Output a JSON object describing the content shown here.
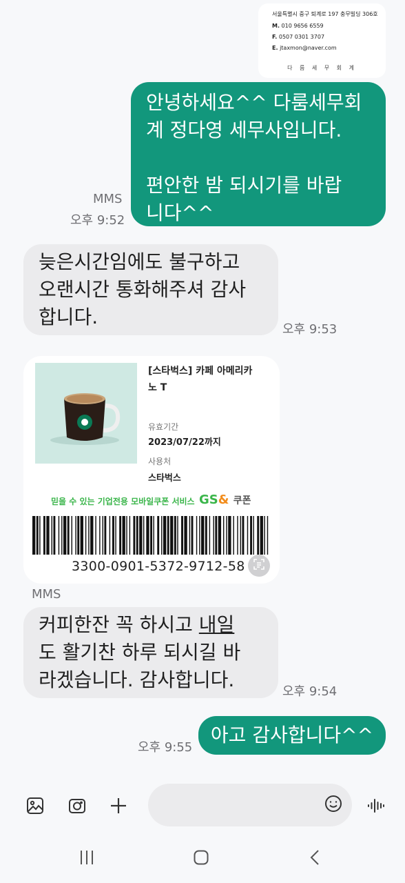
{
  "business_card": {
    "address": "서울특별시 중구 퇴계로 197 충무빌딩 306호",
    "mobile_label": "M.",
    "mobile": "010 9656 6559",
    "fax_label": "F.",
    "fax": "0507 0301 3707",
    "email_label": "E.",
    "email": "jtaxmon@naver.com",
    "firm_name": "다 름  세 무 회 계"
  },
  "messages": {
    "m1": {
      "line1": "안녕하세요^^ 다룸세무회",
      "line2": "계 정다영 세무사입니다.",
      "line3": "편안한 밤 되시기를 바랍",
      "line4": "니다^^",
      "type_label": "MMS",
      "time": "오후 9:52"
    },
    "m2": {
      "line1": "늦은시간임에도 불구하고",
      "line2": "오랜시간 통화해주셔 감사",
      "line3": "합니다.",
      "time": "오후 9:53"
    },
    "coupon": {
      "title_line1": "[스타벅스] 카페 아메리카",
      "title_line2": "노 T",
      "validity_label": "유효기간",
      "validity_value": "2023/07/22까지",
      "store_label": "사용처",
      "store_value": "스타벅스",
      "service_text": "믿을 수 있는 기업전용 모바일쿠폰 서비스",
      "brand_gs": "GS",
      "brand_amp": "&",
      "brand_coupon": "쿠폰",
      "barcode_number": "3300-0901-5372-9712-58",
      "type_label": "MMS"
    },
    "m3": {
      "line1_a": "커피한잔 꼭 하시고 ",
      "line1_b": "내일",
      "line2": "도 활기찬 하루 되시길 바",
      "line3": "라겠습니다. 감사합니다.",
      "time": "오후 9:54"
    },
    "m4": {
      "text": "아고 감사합니다^^",
      "time": "오후 9:55"
    }
  },
  "composer": {
    "gallery_icon": "image-icon",
    "camera_icon": "camera-icon",
    "add_icon": "plus-icon",
    "emoji_icon": "emoji-icon",
    "voice_icon": "voice-icon",
    "input_value": ""
  },
  "navbar": {
    "recent_icon": "recents-icon",
    "home_icon": "home-icon",
    "back_icon": "back-icon"
  },
  "colors": {
    "outgoing_bubble": "#12977c",
    "incoming_bubble": "#ebebed",
    "background": "#f7f8fa"
  }
}
